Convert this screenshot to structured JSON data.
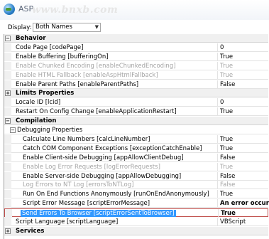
{
  "window": {
    "title": "ASP",
    "watermark": "www.bnxb.com"
  },
  "display": {
    "label": "Display:",
    "value": "Both Names"
  },
  "rows": [
    {
      "kind": "cat",
      "name": "Behavior",
      "expanded": true
    },
    {
      "kind": "prop",
      "name": "Code Page [codePage]",
      "value": "0"
    },
    {
      "kind": "prop",
      "name": "Enable Buffering [bufferingOn]",
      "value": "True"
    },
    {
      "kind": "prop",
      "name": "Enable Chunked Encoding [enableChunkedEncoding]",
      "value": "True",
      "disabled": true
    },
    {
      "kind": "prop",
      "name": "Enable HTML Fallback [enableAspHtmlFallback]",
      "value": "True",
      "disabled": true
    },
    {
      "kind": "prop",
      "name": "Enable Parent Paths [enableParentPaths]",
      "value": "False"
    },
    {
      "kind": "cat",
      "name": "Limits Properties",
      "expanded": false
    },
    {
      "kind": "prop",
      "name": "Locale ID [lcid]",
      "value": "0"
    },
    {
      "kind": "prop",
      "name": "Restart On Config Change [enableApplicationRestart]",
      "value": "True"
    },
    {
      "kind": "cat",
      "name": "Compilation",
      "expanded": true
    },
    {
      "kind": "subcat",
      "name": "Debugging Properties",
      "expanded": true
    },
    {
      "kind": "prop",
      "sub": true,
      "name": "Calculate Line Numbers [calcLineNumber]",
      "value": "True"
    },
    {
      "kind": "prop",
      "sub": true,
      "name": "Catch COM Component Exceptions [exceptionCatchEnable]",
      "value": "True"
    },
    {
      "kind": "prop",
      "sub": true,
      "name": "Enable Client-side Debugging [appAllowClientDebug]",
      "value": "False"
    },
    {
      "kind": "prop",
      "sub": true,
      "name": "Enable Log Error Requests [logErrorRequests]",
      "value": "True",
      "disabled": true
    },
    {
      "kind": "prop",
      "sub": true,
      "name": "Enable Server-side Debugging [appAllowDebugging]",
      "value": "False"
    },
    {
      "kind": "prop",
      "sub": true,
      "name": "Log Errors to NT Log [errorsToNTLog]",
      "value": "False",
      "disabled": true
    },
    {
      "kind": "prop",
      "sub": true,
      "name": "Run On End Functions Anonymously [runOnEndAnonymously]",
      "value": "True"
    },
    {
      "kind": "prop",
      "sub": true,
      "name": "Script Error Message [scriptErrorMessage]",
      "value": "An error occurred",
      "boldValue": true
    },
    {
      "kind": "prop",
      "sub": true,
      "name": "Send Errors To Browser [scriptErrorSentToBrowser]",
      "value": "True",
      "selected": true
    },
    {
      "kind": "prop",
      "name": "Script Language [scriptLanguage]",
      "value": "VBScript"
    },
    {
      "kind": "cat",
      "name": "Services",
      "expanded": false
    }
  ]
}
